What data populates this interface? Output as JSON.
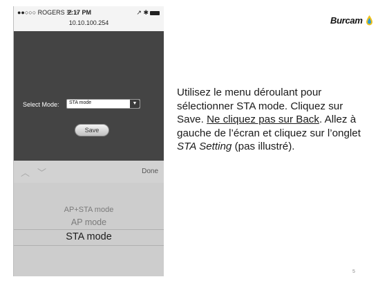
{
  "phone": {
    "status": {
      "carrier": "●●○○○ ROGERS ☴ ☼",
      "time": "2:17 PM",
      "icons": "↗ ✱"
    },
    "url": "10.10.100.254",
    "form": {
      "select_label": "Select Mode:",
      "select_value": "STA mode",
      "save_label": "Save"
    },
    "toolbar": {
      "prev": "︿",
      "next": "﹀",
      "done_label": "Done"
    },
    "picker": {
      "options": [
        "AP+STA mode",
        "AP mode",
        "STA mode"
      ],
      "selected": "STA mode"
    }
  },
  "logo": {
    "text": "Burcam"
  },
  "instructions": {
    "p1": "Utilisez le menu déroulant pour sélectionner STA mode. Cliquez sur Save. ",
    "p2": "Ne cliquez pas sur Back",
    "p3": ". Allez à gauche de l’écran et cliquez sur l’onglet ",
    "p4": "STA Setting",
    "p5": " (pas illustré)."
  },
  "page_number": "5",
  "colors": {
    "webview_bg": "#444444",
    "picker_bg": "#cdcdcd",
    "logo_drop": "#2a9bd6"
  }
}
